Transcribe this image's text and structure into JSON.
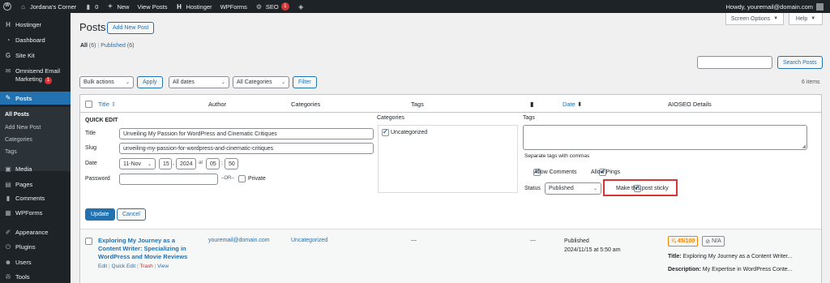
{
  "admin_bar": {
    "site_name": "Jordana's Corner",
    "comments_count": "0",
    "new_label": "New",
    "view_posts": "View Posts",
    "hostinger": "Hostinger",
    "wpforms": "WPForms",
    "seo": "SEO",
    "seo_badge": "1",
    "howdy": "Howdy, youremail@domain.com"
  },
  "sidebar": {
    "hostinger": "Hostinger",
    "dashboard": "Dashboard",
    "site_kit": "Site Kit",
    "omnisend_line1": "Omnisend Email",
    "omnisend_line2": "Marketing",
    "omnisend_badge": "1",
    "posts": "Posts",
    "sub_all_posts": "All Posts",
    "sub_add_new": "Add New Post",
    "sub_categories": "Categories",
    "sub_tags": "Tags",
    "media": "Media",
    "pages": "Pages",
    "comments": "Comments",
    "wpforms": "WPForms",
    "appearance": "Appearance",
    "plugins": "Plugins",
    "users": "Users",
    "tools": "Tools"
  },
  "header": {
    "title": "Posts",
    "add_new": "Add New Post",
    "screen_options": "Screen Options",
    "help": "Help"
  },
  "filters_views": {
    "all": "All",
    "all_count": "(6)",
    "sep": "|",
    "published": "Published",
    "published_count": "(6)"
  },
  "search": {
    "value": "",
    "button": "Search Posts"
  },
  "tablenav": {
    "bulk_actions": "Bulk actions",
    "apply": "Apply",
    "all_dates": "All dates",
    "all_categories": "All Categories",
    "filter": "Filter",
    "items_count": "6 items"
  },
  "columns": {
    "title": "Title",
    "author": "Author",
    "categories": "Categories",
    "tags": "Tags",
    "date": "Date",
    "aioseo": "AIOSEO Details"
  },
  "quick_edit": {
    "heading": "QUICK EDIT",
    "title_label": "Title",
    "title_value": "Unveiling My Passion for WordPress and Cinematic Critiques",
    "slug_label": "Slug",
    "slug_value": "unveiling-my-passion-for-wordpress-and-cinematic-critiques",
    "date_label": "Date",
    "month": "11-Nov",
    "day": "15",
    "year": "2024",
    "at": "at",
    "hour": "05",
    "colon": ":",
    "minute": "50",
    "comma": ",",
    "password_label": "Password",
    "password_value": "",
    "or_label": "–OR–",
    "private_label": "Private",
    "categories_label": "Categories",
    "category_item": "Uncategorized",
    "tags_label": "Tags",
    "tags_hint": "Separate tags with commas",
    "allow_comments": "Allow Comments",
    "allow_pings": "Allow Pings",
    "status_label": "Status",
    "status_value": "Published",
    "sticky_label": "Make this post sticky",
    "update_button": "Update",
    "cancel_button": "Cancel"
  },
  "row": {
    "title": "Exploring My Journey as a Content Writer: Specializing in WordPress and Movie Reviews",
    "title_line1": "Exploring My Journey as a",
    "title_line2": "Content Writer: Specializing in",
    "title_line3": "WordPress and Movie Reviews",
    "action_edit": "Edit",
    "action_quick_edit": "Quick Edit",
    "action_trash": "Trash",
    "action_view": "View",
    "action_sep": "|",
    "author": "youremail@domain.com",
    "category": "Uncategorized",
    "tags": "—",
    "comments": "—",
    "date_status": "Published",
    "date_value": "2024/11/15 at 5:50 am",
    "seo_score": "45/100",
    "seo_na": "N/A",
    "seo_title_label": "Title:",
    "seo_title_value": "Exploring My Journey as a Content Writer...",
    "seo_desc_label": "Description:",
    "seo_desc_value": "My Expertise in WordPress Conte..."
  },
  "colors": {
    "accent": "#2271b1",
    "admin_dark": "#1d2327",
    "danger": "#d63638",
    "seo_orange": "#f18200"
  }
}
